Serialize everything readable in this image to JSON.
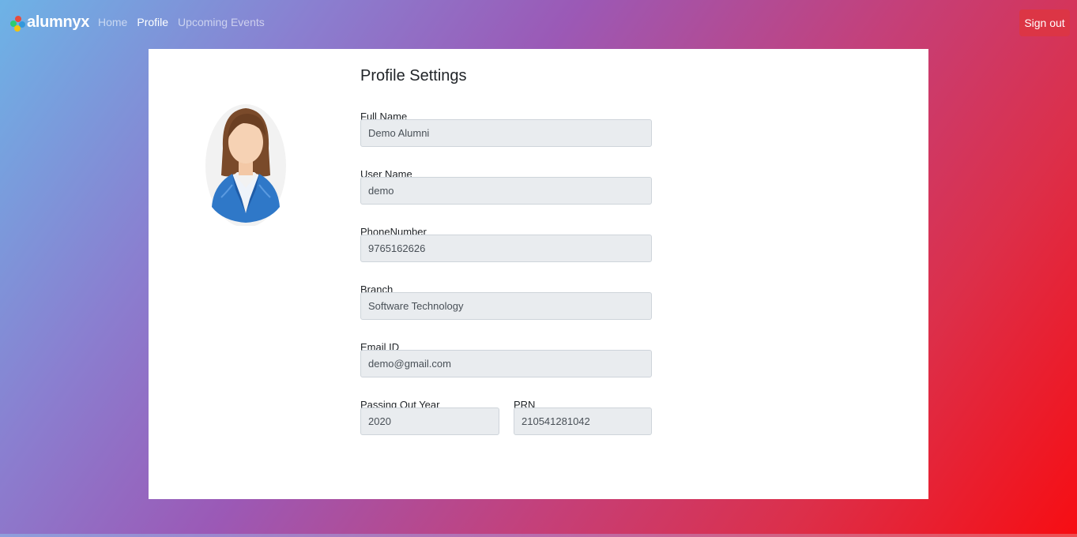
{
  "brand": {
    "name": "alumnyx",
    "logo_colors": [
      "#e74c3c",
      "#2ecc71",
      "#3498db",
      "#f1c40f"
    ]
  },
  "nav": {
    "items": [
      {
        "label": "Home",
        "active": false
      },
      {
        "label": "Profile",
        "active": true
      },
      {
        "label": "Upcoming Events",
        "active": false
      }
    ],
    "signout_label": "Sign out"
  },
  "colors": {
    "signout_bg": "#dc3545",
    "card_bg": "#ffffff",
    "input_bg": "#e9ecef"
  },
  "profile": {
    "title": "Profile Settings",
    "avatar_icon": "female-user-avatar-icon",
    "fields": {
      "full_name": {
        "label": "Full Name",
        "value": "Demo Alumni"
      },
      "user_name": {
        "label": "User Name",
        "value": "demo"
      },
      "phone": {
        "label": "PhoneNumber",
        "value": "9765162626"
      },
      "branch": {
        "label": "Branch",
        "value": "Software Technology"
      },
      "email": {
        "label": "Email ID",
        "value": "demo@gmail.com"
      },
      "passing_year": {
        "label": "Passing Out Year",
        "value": "2020"
      },
      "prn": {
        "label": "PRN",
        "value": "210541281042"
      }
    }
  }
}
